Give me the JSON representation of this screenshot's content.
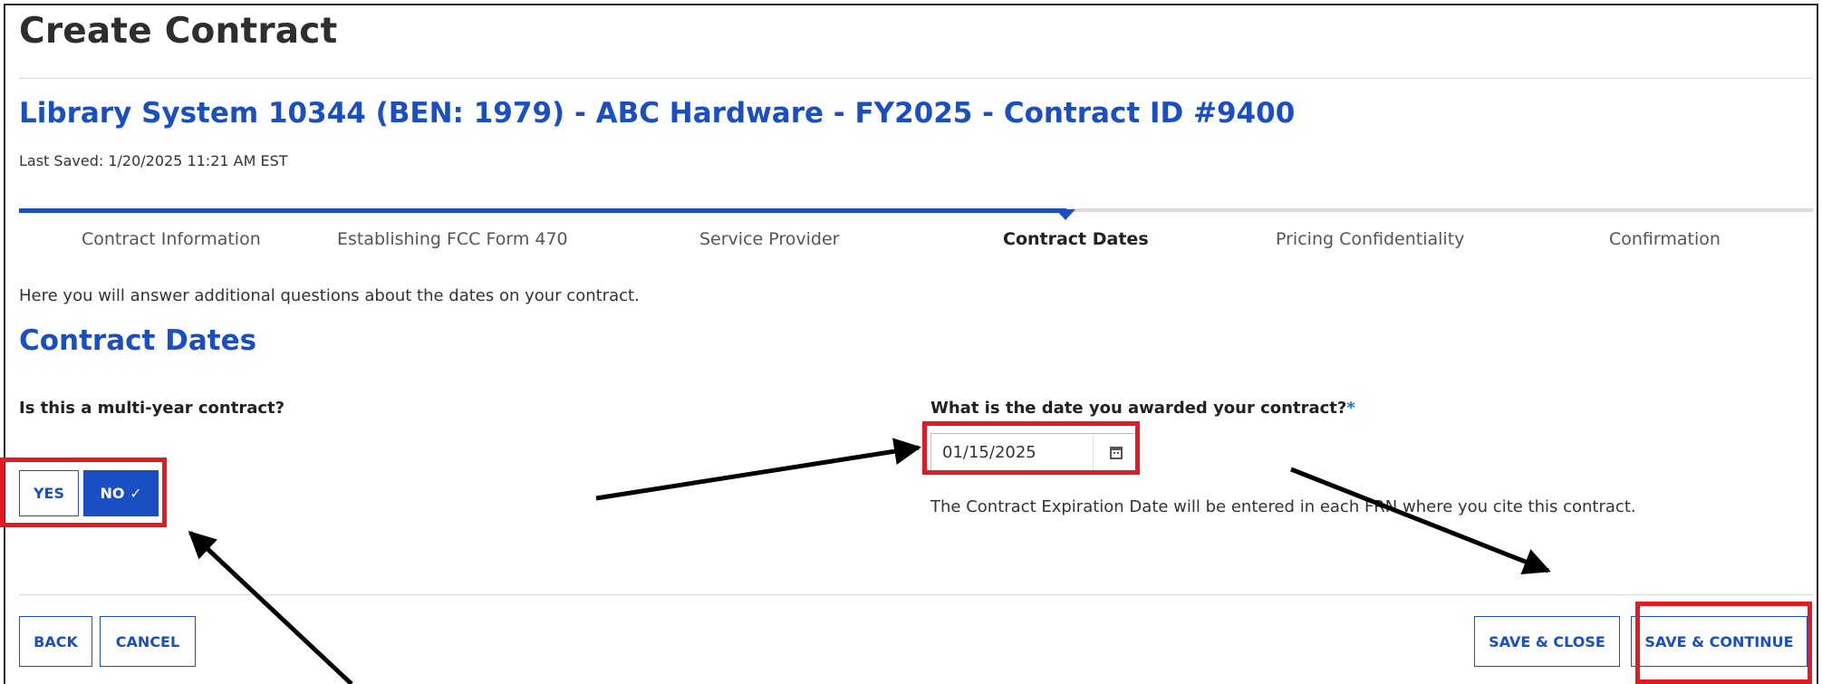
{
  "page": {
    "title": "Create Contract",
    "subtitle": "Library System 10344 (BEN: 1979) - ABC Hardware - FY2025 - Contract ID #9400",
    "last_saved": "Last Saved: 1/20/2025 11:21 AM EST"
  },
  "steps": [
    {
      "label": "Contract Information",
      "active": false
    },
    {
      "label": "Establishing FCC Form 470",
      "active": false
    },
    {
      "label": "Service Provider",
      "active": false
    },
    {
      "label": "Contract Dates",
      "active": true
    },
    {
      "label": "Pricing Confidentiality",
      "active": false
    },
    {
      "label": "Confirmation",
      "active": false
    }
  ],
  "intro_text": "Here you will answer additional questions about the dates on your contract.",
  "section_title": "Contract Dates",
  "multi_year": {
    "question": "Is this a multi-year contract?",
    "yes_label": "YES",
    "no_label": "NO ✓",
    "selected": "NO"
  },
  "award_date": {
    "question": "What is the date you awarded your contract?",
    "required_mark": "*",
    "value": "01/15/2025",
    "icon": "calendar-icon"
  },
  "helper_text": "The Contract Expiration Date will be entered in each FRN where you cite this contract.",
  "footer": {
    "back_label": "BACK",
    "cancel_label": "CANCEL",
    "save_close_label": "SAVE & CLOSE",
    "save_continue_label": "SAVE & CONTINUE"
  },
  "colors": {
    "primary": "#1a4fc4",
    "annotation_red": "#e11b22",
    "annotation_arrow": "#000000"
  }
}
